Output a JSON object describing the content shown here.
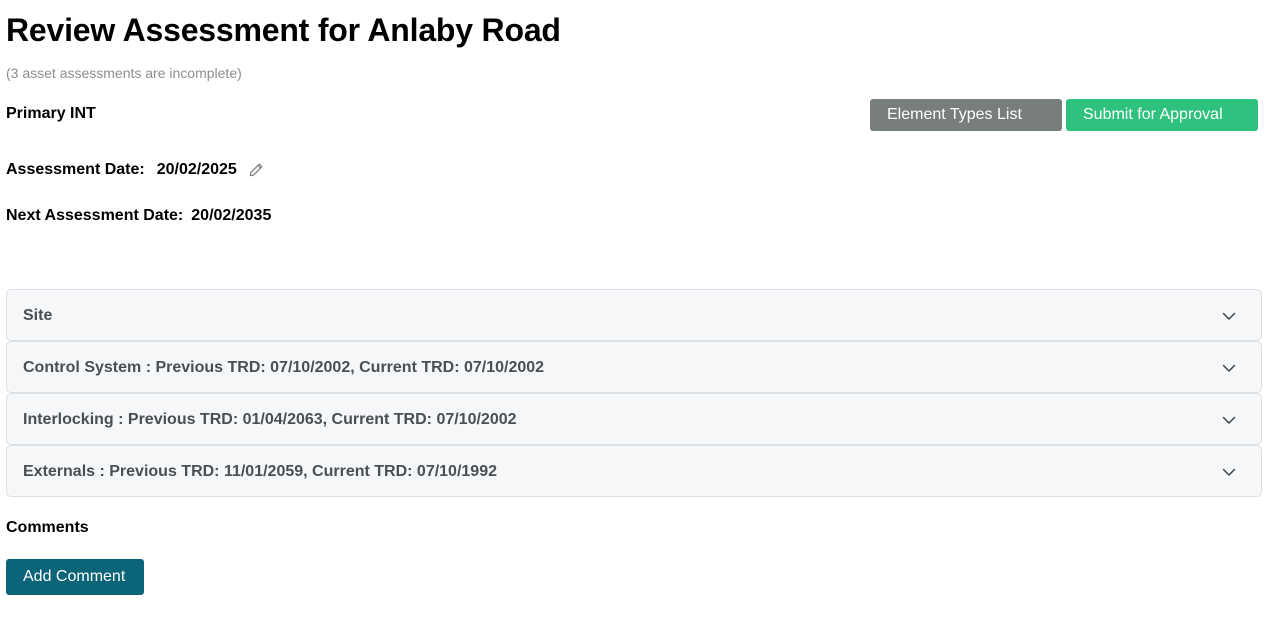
{
  "header": {
    "title": "Review Assessment for Anlaby Road",
    "subtitle": "(3 asset assessments are incomplete)",
    "primary_label": "Primary INT"
  },
  "toolbar": {
    "element_types_label": "Element Types List",
    "submit_label": "Submit for Approval"
  },
  "assessment": {
    "date_label": "Assessment Date:",
    "date_value": "20/02/2025",
    "next_date_label": "Next Assessment Date:",
    "next_date_value": "20/02/2035",
    "edit_icon": "pencil-icon"
  },
  "accordion": {
    "items": [
      {
        "label": "Site",
        "icon": "chevron-down-icon"
      },
      {
        "label": "Control System :  Previous TRD: 07/10/2002, Current TRD: 07/10/2002",
        "icon": "chevron-down-icon"
      },
      {
        "label": "Interlocking :  Previous TRD: 01/04/2063, Current TRD: 07/10/2002",
        "icon": "chevron-down-icon"
      },
      {
        "label": "Externals :  Previous TRD: 11/01/2059, Current TRD: 07/10/1992",
        "icon": "chevron-down-icon"
      }
    ]
  },
  "comments": {
    "label": "Comments",
    "add_label": "Add Comment"
  },
  "colors": {
    "grey_button": "#787d7d",
    "green_button": "#2ec27e",
    "teal_button": "#0b6477",
    "accordion_bg": "#f6f7f9",
    "accordion_text": "#4a4f55",
    "subtitle_text": "#8e8e8e"
  }
}
